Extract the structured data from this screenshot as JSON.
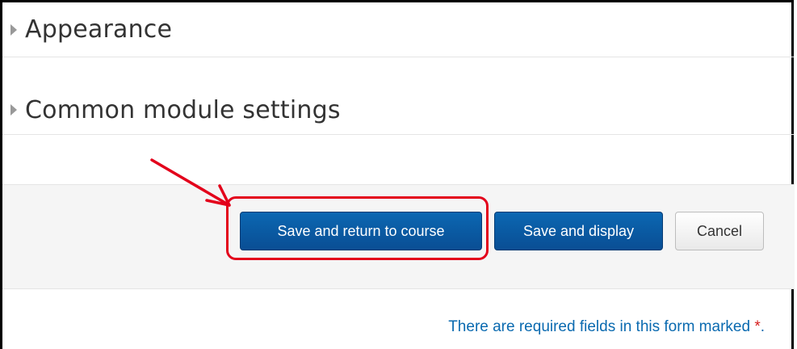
{
  "sections": {
    "appearance": "Appearance",
    "common": "Common module settings"
  },
  "actions": {
    "save_return": "Save and return to course",
    "save_display": "Save and display",
    "cancel": "Cancel"
  },
  "required_note": {
    "text": "There are required fields in this form marked",
    "star": "*",
    "end": "."
  },
  "colors": {
    "primary_button": "#0a5aa4",
    "annotation_red": "#e3001b",
    "link_blue": "#0a6ab0"
  }
}
